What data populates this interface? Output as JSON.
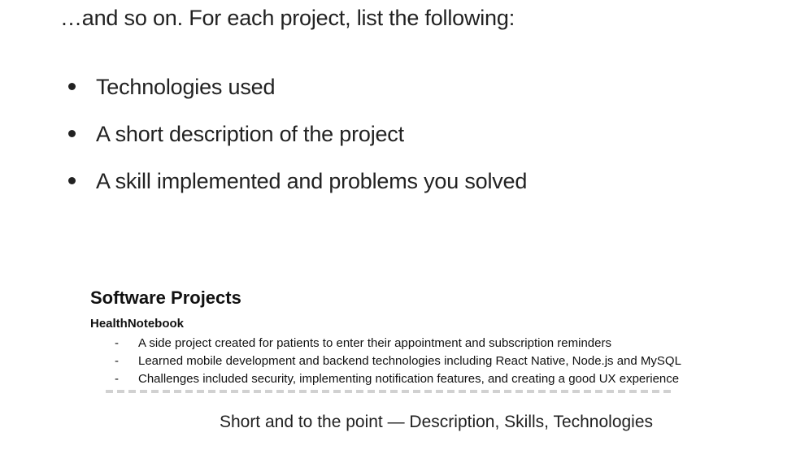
{
  "intro": "…and so on. For each project, list the following:",
  "bullets": [
    "Technologies used",
    "A short description of the project",
    "A skill implemented and problems you solved"
  ],
  "figure": {
    "title": "Software Projects",
    "project_name": "HealthNotebook",
    "items": [
      "A side project created for patients to enter their appointment and subscription reminders",
      "Learned mobile development and backend technologies including React Native, Node.js and MySQL",
      "Challenges included security, implementing notification features, and creating a good UX experience"
    ],
    "dash": "-"
  },
  "caption": "Short and to the point — Description, Skills, Technologies"
}
